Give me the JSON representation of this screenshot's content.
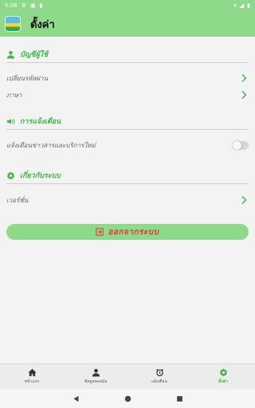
{
  "status_bar": {
    "time": "5:08"
  },
  "app_bar": {
    "title": "ตั้งค่า"
  },
  "sections": {
    "account": {
      "title": "บัญชีผู้ใช้",
      "items": [
        {
          "label": "เปลี่ยนรหัสผ่าน"
        },
        {
          "label": "ภาษา"
        }
      ]
    },
    "notifications": {
      "title": "การแจ้งเตือน",
      "items": [
        {
          "label": "แจ้งเตือนข่าวสารและบริการใหม่",
          "enabled": false
        }
      ]
    },
    "about": {
      "title": "เกี่ยวกับระบบ",
      "items": [
        {
          "label": "เวอร์ชั่น"
        }
      ]
    }
  },
  "logout_label": "ออกจากระบบ",
  "bottom_nav": [
    {
      "label": "หน้าแรก",
      "icon": "home-icon"
    },
    {
      "label": "ข้อมูลของฉัน",
      "icon": "person-icon"
    },
    {
      "label": "แจ้งเตือน",
      "icon": "alarm-icon"
    },
    {
      "label": "ตั้งค่า",
      "icon": "gear-icon",
      "active": true
    }
  ],
  "colors": {
    "accent": "#8fd98a",
    "heading": "#46b54a",
    "danger": "#e53935"
  }
}
